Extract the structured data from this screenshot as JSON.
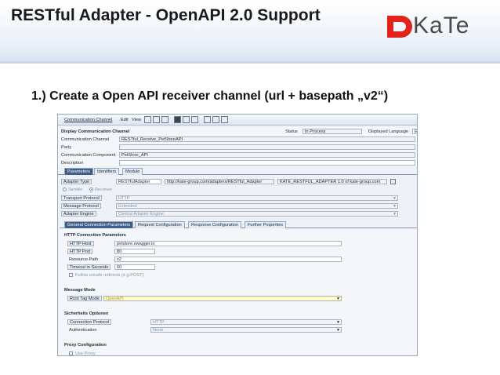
{
  "slide": {
    "title": "RESTful Adapter  - OpenAPI 2.0 Support",
    "logo_text": "KaTe",
    "step": "1.) Create a Open API receiver channel (url + basepath „v2“)"
  },
  "colors": {
    "logo_accent": "#e2231a",
    "tab_active": "#3f5f8a",
    "title_band": "#d9e4f2"
  },
  "sap": {
    "menu": {
      "item1": "Communication Channel",
      "item2": "Edit",
      "item3": "View"
    },
    "header": {
      "title": "Display Communication Channel",
      "status_label": "Status",
      "status_value": "In Process",
      "lang_label": "Displayed Language",
      "lang_value": "E",
      "channel_label": "Communication Channel",
      "channel_value": "RESTful_Receive_PetStoreAPI",
      "party_label": "Party",
      "component_label": "Communication Component",
      "component_value": "PetStore_API",
      "description_label": "Description"
    },
    "tabs": {
      "t1": "Parameters",
      "t2": "Identifiers",
      "t3": "Module"
    },
    "adapter": {
      "type_label": "Adapter Type",
      "type_value": "RESTfulAdapter",
      "namespace": "http://kate-group.com/adapters/RESTful_Adapter",
      "software": "KATE_RESTFUL_ADAPTER 1.0 of kate-group.com",
      "sender_label": "Sender",
      "receiver_label": "Receiver",
      "transport_label": "Transport Protocol",
      "transport_value": "HTTP",
      "message_label": "Message Protocol",
      "message_value": "Extended",
      "engine_label": "Adapter Engine",
      "engine_value": "Central Adapter Engine"
    },
    "subtabs": {
      "s1": "General Connection Parameters",
      "s2": "Request Configuration",
      "s3": "Response Configuration",
      "s4": "Further Properties"
    },
    "http": {
      "section": "HTTP Connection Parameters",
      "host_label": "HTTP Host",
      "host_value": "petstore.swagger.io",
      "port_label": "HTTP Port",
      "port_value": "80",
      "resource_label": "Resource Path",
      "resource_value": "v2",
      "timeout_label": "Timeout in Seconds",
      "timeout_value": "60",
      "follow_label": "Follow unsafe redirects (e.g.POST)"
    },
    "message_mode": {
      "section": "Message Mode",
      "root_label": "Root Tag Mode",
      "root_value": "OpenAPI"
    },
    "security": {
      "section": "Sicherheits Optionen",
      "conn_label": "Connection Protocol",
      "conn_value": "HTTP",
      "auth_label": "Authentication",
      "auth_value": "None"
    },
    "proxy": {
      "section": "Proxy Configuration",
      "use_label": "Use Proxy"
    }
  }
}
